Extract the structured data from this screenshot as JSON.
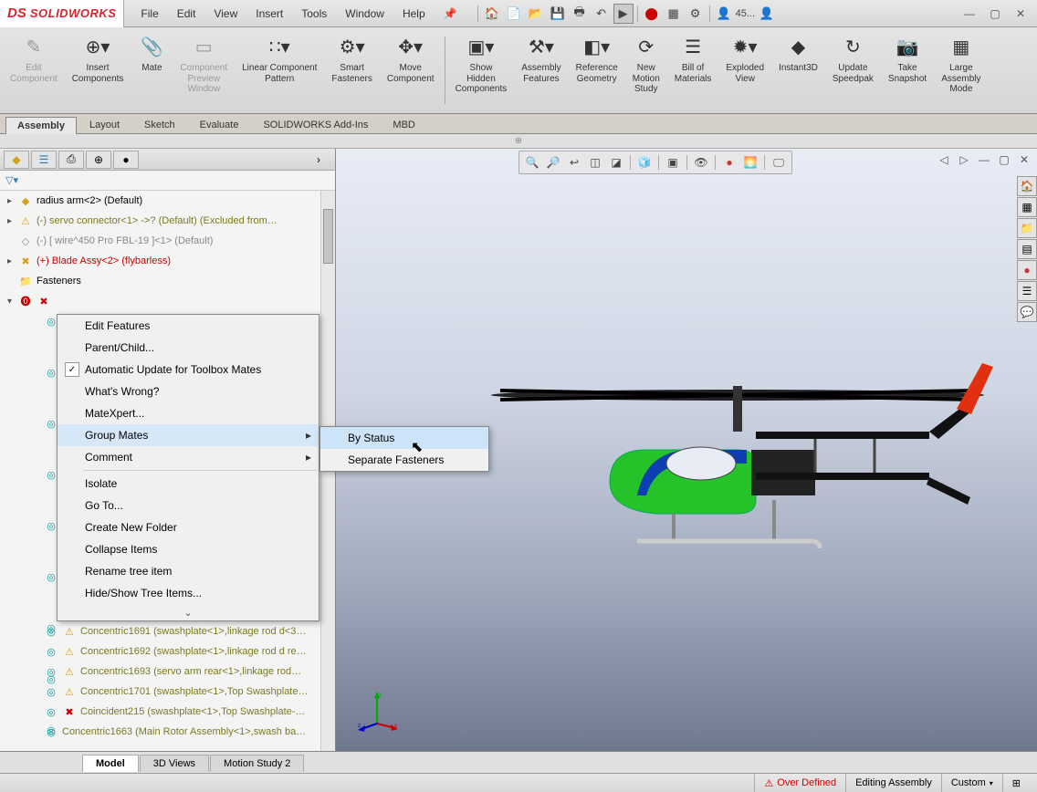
{
  "app": {
    "name": "SOLIDWORKS",
    "account_short": "45..."
  },
  "menu": [
    "File",
    "Edit",
    "View",
    "Insert",
    "Tools",
    "Window",
    "Help"
  ],
  "ribbon": [
    {
      "label": "Edit\nComponent",
      "disabled": true,
      "icon": "✎"
    },
    {
      "label": "Insert\nComponents",
      "icon": "⊕▾"
    },
    {
      "label": "Mate",
      "icon": "📎"
    },
    {
      "label": "Component\nPreview\nWindow",
      "disabled": true,
      "icon": "▭"
    },
    {
      "label": "Linear Component\nPattern",
      "icon": "∷▾"
    },
    {
      "label": "Smart\nFasteners",
      "icon": "⚙▾"
    },
    {
      "label": "Move\nComponent",
      "icon": "✥▾"
    },
    {
      "label": "Show\nHidden\nComponents",
      "icon": "▣▾"
    },
    {
      "label": "Assembly\nFeatures",
      "icon": "⚒▾"
    },
    {
      "label": "Reference\nGeometry",
      "icon": "◧▾"
    },
    {
      "label": "New\nMotion\nStudy",
      "icon": "⟳"
    },
    {
      "label": "Bill of\nMaterials",
      "icon": "☰"
    },
    {
      "label": "Exploded\nView",
      "icon": "✹▾"
    },
    {
      "label": "Instant3D",
      "icon": "◆"
    },
    {
      "label": "Update\nSpeedpak",
      "icon": "↻"
    },
    {
      "label": "Take\nSnapshot",
      "icon": "📷"
    },
    {
      "label": "Large\nAssembly\nMode",
      "icon": "▦"
    }
  ],
  "tabs": [
    "Assembly",
    "Layout",
    "Sketch",
    "Evaluate",
    "SOLIDWORKS Add-Ins",
    "MBD"
  ],
  "tree": [
    {
      "icon": "▸",
      "ic": "tyellow",
      "glyph": "◆",
      "text": "radius arm<2> (Default)",
      "cls": ""
    },
    {
      "icon": "▸",
      "ic": "tyellow",
      "glyph": "⚠",
      "text": "(-) servo connector<1> ->? (Default) (Excluded from…",
      "cls": "tolive"
    },
    {
      "icon": " ",
      "ic": "tgray",
      "glyph": "◇",
      "text": "(-) [ wire^450 Pro FBL-19 ]<1> (Default)",
      "cls": "tgray"
    },
    {
      "icon": "▸",
      "ic": "tyellow",
      "glyph": "✖",
      "text": "(+) Blade Assy<2> (flybarless)",
      "cls": "tred"
    },
    {
      "icon": " ",
      "ic": "tblue",
      "glyph": "📁",
      "text": "Fasteners",
      "cls": ""
    }
  ],
  "mates": [
    {
      "glyph": "⚠",
      "text": "Concentric1691 (swashplate<1>,linkage rod d<3…"
    },
    {
      "glyph": "⚠",
      "text": "Concentric1692 (swashplate<1>,linkage rod d re…"
    },
    {
      "glyph": "⚠",
      "text": "Concentric1693 (servo arm rear<1>,linkage rod…"
    },
    {
      "glyph": "⚠",
      "text": "Concentric1701 (swashplate<1>,Top Swashplate…"
    },
    {
      "glyph": "✖",
      "text": "Coincident215 (swashplate<1>,Top Swashplate-…"
    },
    {
      "glyph": "◎",
      "text": "Concentric1663 (Main Rotor Assembly<1>,swash ba…"
    }
  ],
  "context_menu": [
    {
      "label": "Edit Features"
    },
    {
      "label": "Parent/Child..."
    },
    {
      "label": "Automatic Update for Toolbox Mates",
      "checked": true
    },
    {
      "label": "What's Wrong?"
    },
    {
      "label": "MateXpert..."
    },
    {
      "label": "Group Mates",
      "arrow": true,
      "highlight": true
    },
    {
      "label": "Comment",
      "arrow": true
    },
    {
      "sep": true
    },
    {
      "label": "Isolate"
    },
    {
      "label": "Go To..."
    },
    {
      "label": "Create New Folder"
    },
    {
      "label": "Collapse Items"
    },
    {
      "label": "Rename tree item"
    },
    {
      "label": "Hide/Show Tree Items..."
    }
  ],
  "submenu": [
    {
      "label": "By Status",
      "highlight": true
    },
    {
      "label": "Separate Fasteners"
    }
  ],
  "bottom_tabs": [
    "Model",
    "3D Views",
    "Motion Study 2"
  ],
  "status": {
    "over_defined": "Over Defined",
    "mode": "Editing Assembly",
    "custom": "Custom"
  }
}
